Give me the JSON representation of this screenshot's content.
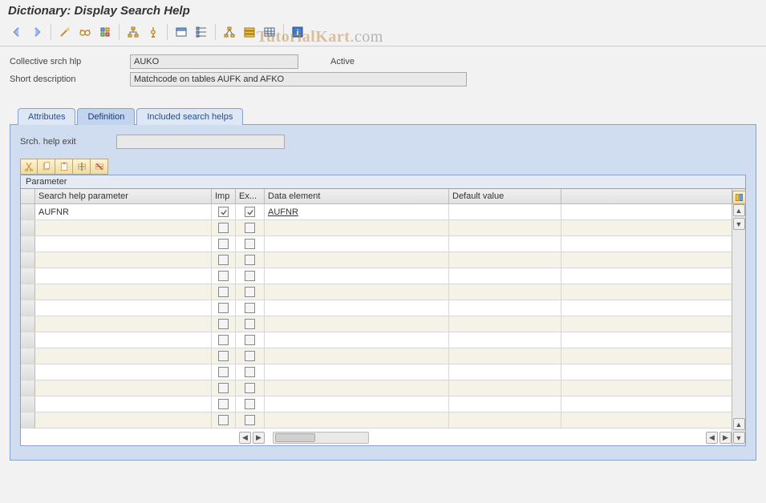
{
  "title": "Dictionary: Display Search Help",
  "watermark": {
    "part1": "Tutorial",
    "part2": "Kart",
    "part3": ".com"
  },
  "fields": {
    "collective_label": "Collective srch hlp",
    "collective_value": "AUKO",
    "status": "Active",
    "short_desc_label": "Short description",
    "short_desc_value": "Matchcode on tables AUFK and AFKO"
  },
  "tabs": {
    "items": [
      {
        "label": "Attributes"
      },
      {
        "label": "Definition"
      },
      {
        "label": "Included search helps"
      }
    ],
    "active_index": 1
  },
  "panel": {
    "search_exit_label": "Srch. help exit",
    "search_exit_value": "",
    "parameter_title": "Parameter",
    "columns": {
      "param": "Search help parameter",
      "imp": "Imp",
      "exp": "Ex...",
      "de": "Data element",
      "def": "Default value"
    },
    "rows": [
      {
        "param": "AUFNR",
        "imp": true,
        "exp": true,
        "de": "AUFNR",
        "def": ""
      }
    ],
    "empty_row_count": 13
  },
  "icons": {
    "back": "back-icon",
    "forward": "forward-icon",
    "wand": "wand-icon",
    "glasses": "glasses-icon",
    "activate": "activate-icon",
    "hierarchy": "hierarchy-icon",
    "match": "match-icon",
    "window": "window-icon",
    "tree": "tree-icon",
    "graph": "graph-icon",
    "stack": "stack-icon",
    "grid": "grid-icon",
    "doc": "doc-icon",
    "help": "help-icon"
  }
}
